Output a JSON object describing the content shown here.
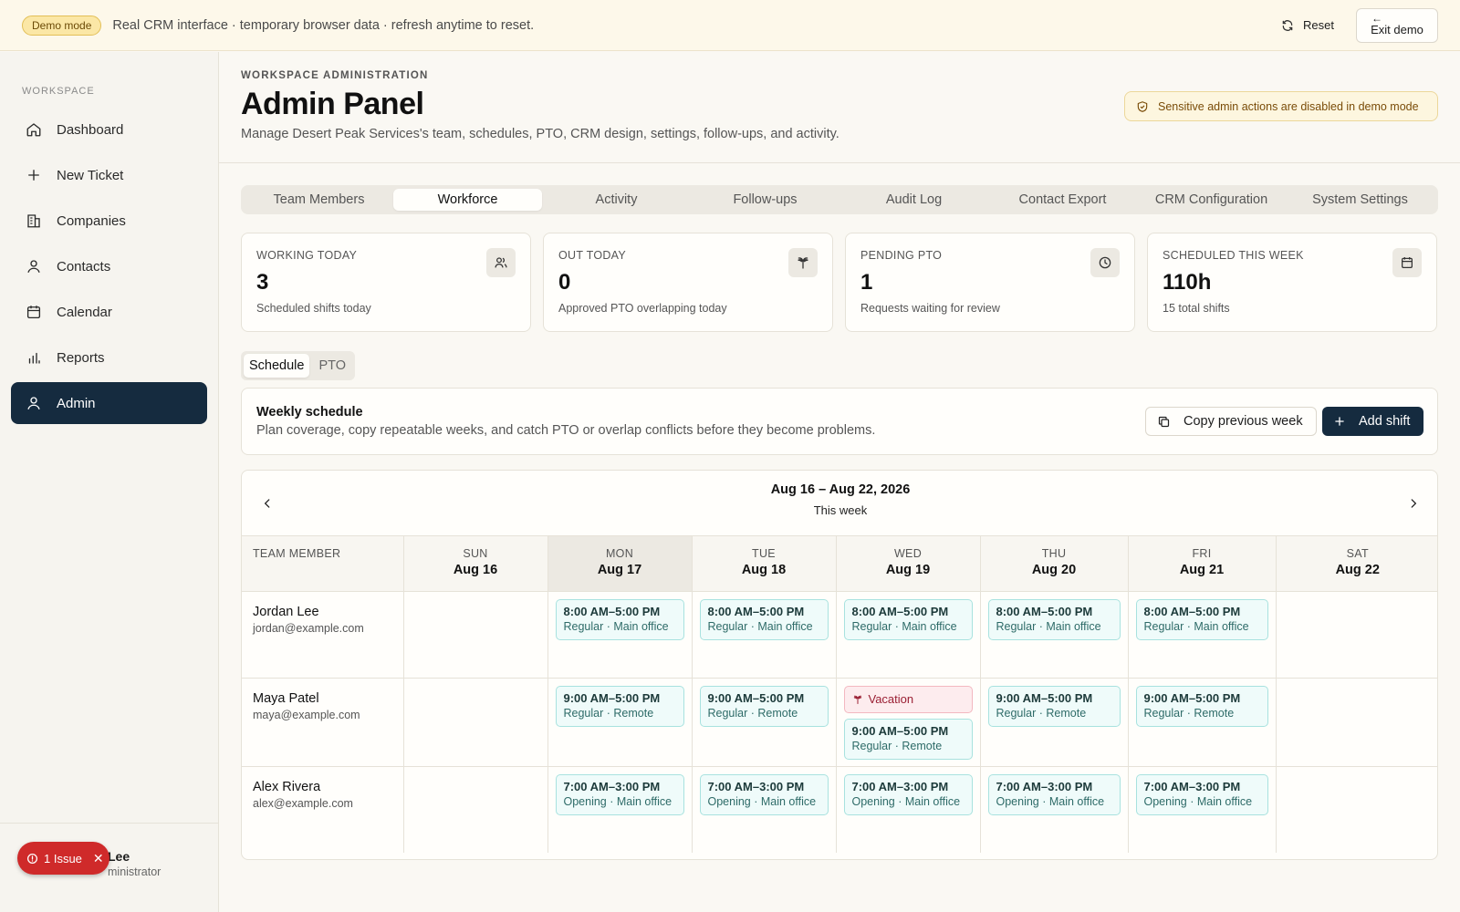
{
  "banner": {
    "badge": "Demo mode",
    "text": "Real CRM interface · temporary browser data · refresh anytime to reset.",
    "reset_label": "Reset",
    "exit_label": "Exit demo"
  },
  "sidebar": {
    "section_label": "WORKSPACE",
    "items": [
      {
        "label": "Dashboard",
        "icon": "home-icon"
      },
      {
        "label": "New Ticket",
        "icon": "plus-icon"
      },
      {
        "label": "Companies",
        "icon": "building-icon"
      },
      {
        "label": "Contacts",
        "icon": "user-icon"
      },
      {
        "label": "Calendar",
        "icon": "calendar-icon"
      },
      {
        "label": "Reports",
        "icon": "bar-chart-icon"
      },
      {
        "label": "Admin",
        "icon": "user-icon",
        "active": true
      }
    ],
    "user": {
      "name": "Lee",
      "role": "ministrator"
    },
    "issue_label": "1 Issue"
  },
  "header": {
    "eyebrow": "WORKSPACE ADMINISTRATION",
    "title": "Admin Panel",
    "subtitle": "Manage Desert Peak Services's team, schedules, PTO, CRM design, settings, follow-ups, and activity.",
    "warning": "Sensitive admin actions are disabled in demo mode"
  },
  "tabs": [
    "Team Members",
    "Workforce",
    "Activity",
    "Follow-ups",
    "Audit Log",
    "Contact Export",
    "CRM Configuration",
    "System Settings"
  ],
  "active_tab": "Workforce",
  "stats": [
    {
      "label": "WORKING TODAY",
      "value": "3",
      "desc": "Scheduled shifts today",
      "icon": "users-icon"
    },
    {
      "label": "OUT TODAY",
      "value": "0",
      "desc": "Approved PTO overlapping today",
      "icon": "palm-tree-icon"
    },
    {
      "label": "PENDING PTO",
      "value": "1",
      "desc": "Requests waiting for review",
      "icon": "clock-icon"
    },
    {
      "label": "SCHEDULED THIS WEEK",
      "value": "110h",
      "desc": "15 total shifts",
      "icon": "calendar-grid-icon"
    }
  ],
  "subtabs": {
    "schedule": "Schedule",
    "pto": "PTO"
  },
  "weekly": {
    "title": "Weekly schedule",
    "desc": "Plan coverage, copy repeatable weeks, and catch PTO or overlap conflicts before they become problems.",
    "copy_label": "Copy previous week",
    "add_label": "Add shift"
  },
  "calendar": {
    "range": "Aug 16 – Aug 22, 2026",
    "range_sub": "This week",
    "member_header": "TEAM MEMBER",
    "days": [
      {
        "name": "SUN",
        "date": "Aug 16"
      },
      {
        "name": "MON",
        "date": "Aug 17",
        "today": true
      },
      {
        "name": "TUE",
        "date": "Aug 18"
      },
      {
        "name": "WED",
        "date": "Aug 19"
      },
      {
        "name": "THU",
        "date": "Aug 20"
      },
      {
        "name": "FRI",
        "date": "Aug 21"
      },
      {
        "name": "SAT",
        "date": "Aug 22"
      }
    ],
    "members": [
      {
        "name": "Jordan Lee",
        "email": "jordan@example.com",
        "cells": [
          null,
          {
            "time": "8:00 AM–5:00 PM",
            "sub": "Regular · Main office"
          },
          {
            "time": "8:00 AM–5:00 PM",
            "sub": "Regular · Main office"
          },
          {
            "time": "8:00 AM–5:00 PM",
            "sub": "Regular · Main office"
          },
          {
            "time": "8:00 AM–5:00 PM",
            "sub": "Regular · Main office"
          },
          {
            "time": "8:00 AM–5:00 PM",
            "sub": "Regular · Main office"
          },
          null
        ]
      },
      {
        "name": "Maya Patel",
        "email": "maya@example.com",
        "cells": [
          null,
          {
            "time": "9:00 AM–5:00 PM",
            "sub": "Regular · Remote"
          },
          {
            "time": "9:00 AM–5:00 PM",
            "sub": "Regular · Remote"
          },
          {
            "pto": "Vacation",
            "time": "9:00 AM–5:00 PM",
            "sub": "Regular · Remote"
          },
          {
            "time": "9:00 AM–5:00 PM",
            "sub": "Regular · Remote"
          },
          {
            "time": "9:00 AM–5:00 PM",
            "sub": "Regular · Remote"
          },
          null
        ]
      },
      {
        "name": "Alex Rivera",
        "email": "alex@example.com",
        "cells": [
          null,
          {
            "time": "7:00 AM–3:00 PM",
            "sub": "Opening · Main office"
          },
          {
            "time": "7:00 AM–3:00 PM",
            "sub": "Opening · Main office"
          },
          {
            "time": "7:00 AM–3:00 PM",
            "sub": "Opening · Main office"
          },
          {
            "time": "7:00 AM–3:00 PM",
            "sub": "Opening · Main office"
          },
          {
            "time": "7:00 AM–3:00 PM",
            "sub": "Opening · Main office"
          },
          null
        ]
      }
    ]
  },
  "colors": {
    "accent": "#152b3f",
    "shift_bg": "#effbfa",
    "pto_bg": "#fdecee",
    "issue": "#cf2a2a"
  }
}
